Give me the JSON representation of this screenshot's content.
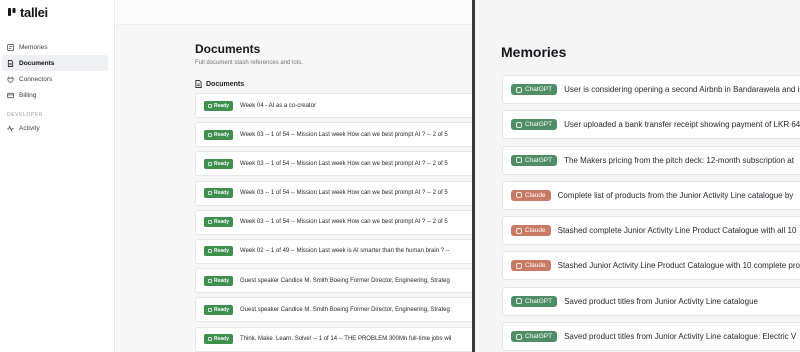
{
  "app": {
    "name": "tallei"
  },
  "sidebar": {
    "items": [
      {
        "label": "Memories",
        "icon": "memory-card-icon",
        "active": false
      },
      {
        "label": "Documents",
        "icon": "document-icon",
        "active": true
      },
      {
        "label": "Connectors",
        "icon": "plug-icon",
        "active": false
      },
      {
        "label": "Billing",
        "icon": "credit-card-icon",
        "active": false
      }
    ],
    "developer_section": "DEVELOPER",
    "developer_items": [
      {
        "label": "Activity",
        "icon": "activity-pulse-icon"
      }
    ]
  },
  "documents": {
    "title": "Documents",
    "subtitle": "Full document stash references and lots.",
    "section_label": "Documents",
    "status_label": "Ready",
    "rows": [
      {
        "status": "Ready",
        "title": "Week 04 - AI as a co-creator"
      },
      {
        "status": "Ready",
        "title": "Week 03 -- 1 of 54 -- Mission Last week How can we best prompt AI ? -- 2 of 5"
      },
      {
        "status": "Ready",
        "title": "Week 03 -- 1 of 54 -- Mission Last week How can we best prompt AI ? -- 2 of 5"
      },
      {
        "status": "Ready",
        "title": "Week 03 -- 1 of 54 -- Mission Last week How can we best prompt AI ? -- 2 of 5"
      },
      {
        "status": "Ready",
        "title": "Week 03 -- 1 of 54 -- Mission Last week How can we best prompt AI ? -- 2 of 5"
      },
      {
        "status": "Ready",
        "title": "Week 02 -- 1 of 49 -- Mission Last week is AI smarter than the human brain ? --"
      },
      {
        "status": "Ready",
        "title": "Guest speaker Candice M. Smith Boeing Former Director, Engineering, Strateg"
      },
      {
        "status": "Ready",
        "title": "Guest speaker Candice M. Smith Boeing Former Director, Engineering, Strateg"
      },
      {
        "status": "Ready",
        "title": "Think. Make. Learn. Solve! -- 1 of 14 -- THE PROBLEM 300Mn full-time jobs wil"
      }
    ]
  },
  "memories": {
    "title": "Memories",
    "rows": [
      {
        "source": "ChatGPT",
        "kind": "chatgpt",
        "text": "User is considering opening a second Airbnb in Bandarawela and is"
      },
      {
        "source": "ChatGPT",
        "kind": "chatgpt",
        "text": "User uploaded a bank transfer receipt showing payment of LKR 64"
      },
      {
        "source": "ChatGPT",
        "kind": "chatgpt",
        "text": "The Makers pricing from the pitch deck: 12-month subscription at"
      },
      {
        "source": "Claude",
        "kind": "claude",
        "text": "Complete list of products from the Junior Activity Line catalogue by"
      },
      {
        "source": "Claude",
        "kind": "claude",
        "text": "Stashed complete Junior Activity Line Product Catalogue with all 10"
      },
      {
        "source": "Claude",
        "kind": "claude",
        "text": "Stashed Junior Activity Line Product Catalogue with 10 complete pro"
      },
      {
        "source": "ChatGPT",
        "kind": "chatgpt",
        "text": "Saved product titles from Junior Activity Line catalogue"
      },
      {
        "source": "ChatGPT",
        "kind": "chatgpt",
        "text": "Saved product titles from Junior Activity Line catalogue: Electric V"
      }
    ]
  },
  "colors": {
    "ready_badge": "#3f8f4f",
    "chatgpt_badge": "#4e8d66",
    "claude_badge": "#c97a64",
    "divider": "#3a3a3a"
  }
}
